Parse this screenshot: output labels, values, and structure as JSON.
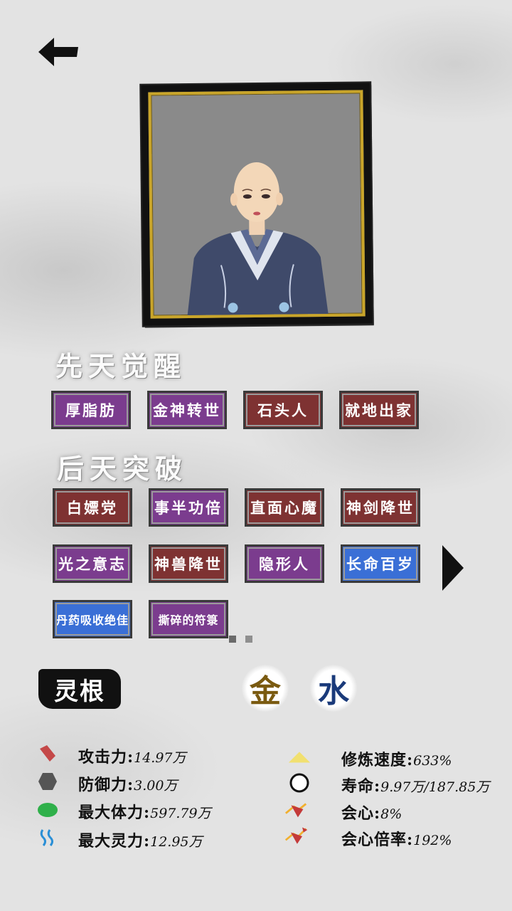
{
  "innate": {
    "title": "先天觉醒",
    "tags": [
      {
        "label": "厚脂肪",
        "color": "purple"
      },
      {
        "label": "金神转世",
        "color": "purple"
      },
      {
        "label": "石头人",
        "color": "red"
      },
      {
        "label": "就地出家",
        "color": "red"
      }
    ]
  },
  "acquired": {
    "title": "后天突破",
    "tags": [
      {
        "label": "白嫖党",
        "color": "red"
      },
      {
        "label": "事半功倍",
        "color": "purple"
      },
      {
        "label": "直面心魔",
        "color": "red"
      },
      {
        "label": "神剑降世",
        "color": "red"
      },
      {
        "label": "光之意志",
        "color": "purple"
      },
      {
        "label": "神兽降世",
        "color": "red"
      },
      {
        "label": "隐形人",
        "color": "purple"
      },
      {
        "label": "长命百岁",
        "color": "blue"
      },
      {
        "label": "丹药吸收绝佳",
        "color": "blue"
      },
      {
        "label": "撕碎的符箓",
        "color": "purple"
      }
    ],
    "page_current": 1,
    "page_total": 2
  },
  "spirit_root": {
    "label": "灵根",
    "elements": [
      {
        "char": "金",
        "color": "#7a5a10"
      },
      {
        "char": "水",
        "color": "#1a3a7a"
      }
    ]
  },
  "stats_left": [
    {
      "icon": "attack-icon",
      "name": "攻击力:",
      "value": "14.97万"
    },
    {
      "icon": "defense-icon",
      "name": "防御力:",
      "value": "3.00万"
    },
    {
      "icon": "health-icon",
      "name": "最大体力:",
      "value": "597.79万"
    },
    {
      "icon": "spirit-icon",
      "name": "最大灵力:",
      "value": "12.95万"
    }
  ],
  "stats_right": [
    {
      "icon": "cultivation-speed-icon",
      "name": "修炼速度:",
      "value": "633%"
    },
    {
      "icon": "lifespan-icon",
      "name": "寿命:",
      "value": "9.97万/187.85万"
    },
    {
      "icon": "crit-icon",
      "name": "会心:",
      "value": "8%"
    },
    {
      "icon": "crit-multiplier-icon",
      "name": "会心倍率:",
      "value": "192%"
    }
  ],
  "colors": {
    "purple": "#7b3c8e",
    "red": "#7e3232",
    "blue": "#3a6fd6",
    "gold_frame": "#c9a52a"
  }
}
